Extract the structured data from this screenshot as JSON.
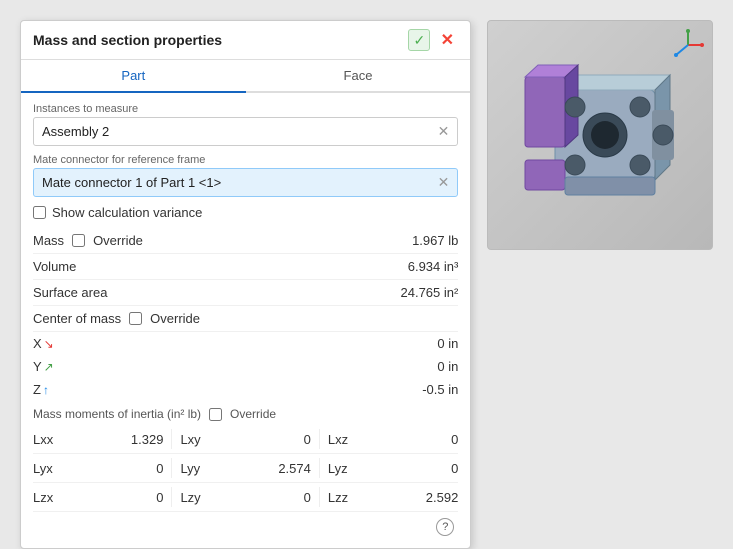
{
  "panel": {
    "title": "Mass and section properties",
    "tabs": [
      {
        "label": "Part",
        "active": true
      },
      {
        "label": "Face",
        "active": false
      }
    ],
    "instances_label": "Instances to measure",
    "instances_value": "Assembly 2",
    "mate_connector_label": "Mate connector for reference frame",
    "mate_connector_value": "Mate connector 1 of Part 1 <1>",
    "show_variance_label": "Show calculation variance",
    "mass_label": "Mass",
    "mass_override": "Override",
    "mass_value": "1.967 lb",
    "volume_label": "Volume",
    "volume_value": "6.934 in³",
    "surface_area_label": "Surface area",
    "surface_area_value": "24.765 in²",
    "center_of_mass_label": "Center of mass",
    "center_of_mass_override": "Override",
    "x_label": "X",
    "x_value": "0 in",
    "y_label": "Y",
    "y_value": "0 in",
    "z_label": "Z",
    "z_value": "-0.5 in",
    "inertia_label": "Mass moments of inertia (in² lb)",
    "inertia_override": "Override",
    "lxx_label": "Lxx",
    "lxx_value": "1.329",
    "lxy_label": "Lxy",
    "lxy_value": "0",
    "lxz_label": "Lxz",
    "lxz_value": "0",
    "lyx_label": "Lyx",
    "lyx_value": "0",
    "lyy_label": "Lyy",
    "lyy_value": "2.574",
    "lyz_label": "Lyz",
    "lyz_value": "0",
    "lzx_label": "Lzx",
    "lzx_value": "0",
    "lzy_label": "Lzy",
    "lzy_value": "0",
    "lzz_label": "Lzz",
    "lzz_value": "2.592",
    "help_icon": "?"
  },
  "colors": {
    "active_tab": "#1565c0",
    "check_bg": "#e8f5e9",
    "check_color": "#4caf50",
    "x_color": "#e53935",
    "close_color": "#f44336"
  }
}
